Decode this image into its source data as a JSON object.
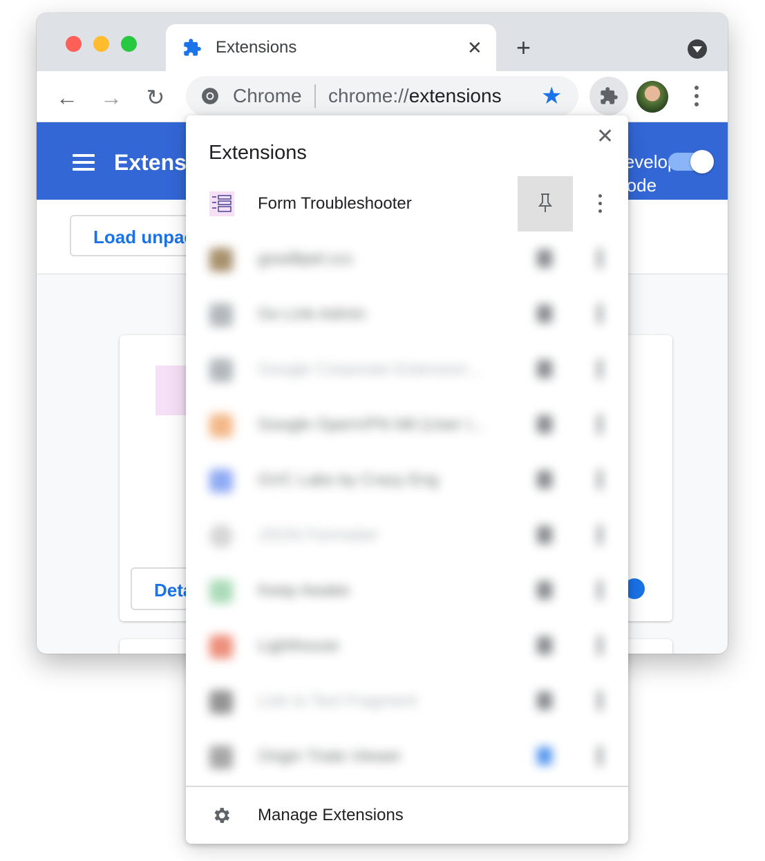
{
  "browser": {
    "tab": {
      "title": "Extensions",
      "close_glyph": "✕"
    },
    "new_tab_glyph": "+",
    "omnibox": {
      "chip": "Chrome",
      "url_prefix": "chrome://",
      "url_path": "extensions",
      "bookmarked": true
    },
    "nav": {
      "back": "←",
      "forward": "→",
      "reload": "↻"
    },
    "star_glyph": "★"
  },
  "page": {
    "title": "Extensions",
    "dev_mode_label": "Developer mode",
    "dev_mode_on": true,
    "load_unpacked": "Load unpacked",
    "details": "Details"
  },
  "popup": {
    "title": "Extensions",
    "close_glyph": "✕",
    "items": [
      {
        "name": "Form Troubleshooter",
        "icon": "form-troubleshooter-icon",
        "pinned": false,
        "blurred": false
      },
      {
        "name": "goodlipel.ccc",
        "icon_color": "#8a6a3a",
        "blurred": true
      },
      {
        "name": "Go Link Admin",
        "icon_color": "#9aa0a6",
        "blurred": true
      },
      {
        "name": "Google Corporate Extension...",
        "icon_color": "#9aa0a6",
        "blurred": true
      },
      {
        "name": "Google OpenVPN Mil (User I...",
        "icon_color": "#f0a060",
        "blurred": true
      },
      {
        "name": "GVC Labs by Crazy Eng",
        "icon_color": "#6b8ff0",
        "blurred": true
      },
      {
        "name": "JSON Formatter",
        "icon_color": "#c8c8c8",
        "blurred": true
      },
      {
        "name": "Keep Awake",
        "icon_color": "#8fd0a0",
        "blurred": true
      },
      {
        "name": "Lighthouse",
        "icon_color": "#e86a50",
        "blurred": true
      },
      {
        "name": "Link to Text Fragment",
        "icon_color": "#707070",
        "blurred": true
      },
      {
        "name": "Origin Trials Viewer",
        "icon_color": "#8a8a8a",
        "blurred": true,
        "pinned": true
      }
    ],
    "manage": "Manage Extensions"
  },
  "colors": {
    "accent": "#1a73e8",
    "header": "#3367d6"
  }
}
